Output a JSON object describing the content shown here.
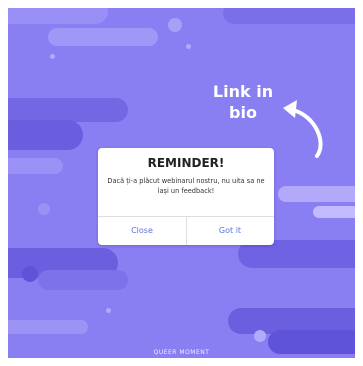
{
  "overlay": {
    "link_text": "Link in bio"
  },
  "dialog": {
    "title": "REMINDER!",
    "message": "Dacă ți-a plăcut webinarul nostru, nu uita sa ne lași un feedback!",
    "close_label": "Close",
    "confirm_label": "Got it"
  },
  "footer": {
    "brand": "QUEER MOMENT"
  },
  "colors": {
    "background": "#8a7ff2",
    "button_text": "#5a74d8"
  }
}
